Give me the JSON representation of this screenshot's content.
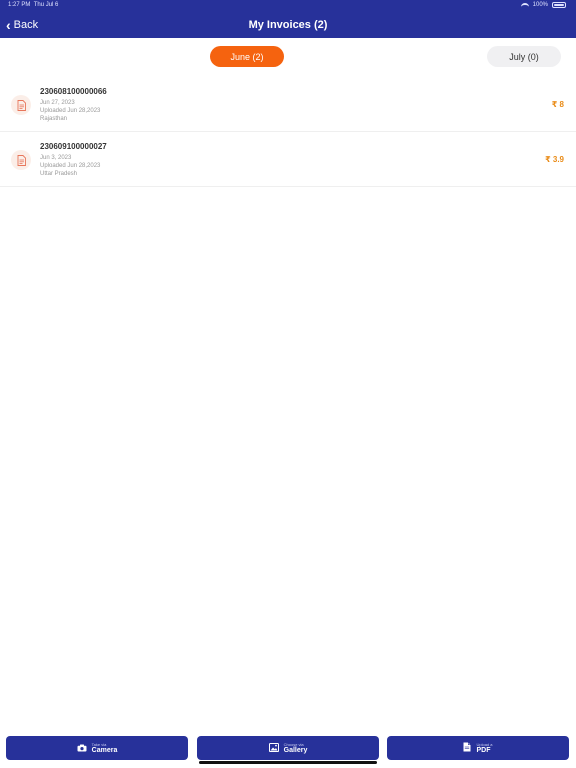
{
  "status_bar": {
    "time": "1:27 PM",
    "date": "Thu Jul 6",
    "battery": "100%"
  },
  "header": {
    "back_label": "Back",
    "title": "My Invoices (2)",
    "bg_color": "#27319a"
  },
  "tabs": [
    {
      "label": "June (2)",
      "selected": true,
      "color": "#f5630f"
    },
    {
      "label": "July (0)",
      "selected": false
    }
  ],
  "invoices": [
    {
      "id": "230608100000066",
      "date": "Jun 27, 2023",
      "uploaded": "Uploaded Jun 28,2023",
      "state": "Rajasthan",
      "amount": "₹ 8",
      "icon": "document-icon"
    },
    {
      "id": "230609100000027",
      "date": "Jun 3, 2023",
      "uploaded": "Uploaded Jun 28,2023",
      "state": "Uttar Pradesh",
      "amount": "₹ 3.9",
      "icon": "document-icon"
    }
  ],
  "actions": [
    {
      "sub": "Take via",
      "label": "Camera",
      "icon": "camera-icon"
    },
    {
      "sub": "Choose via",
      "label": "Gallery",
      "icon": "gallery-icon"
    },
    {
      "sub": "Upload a",
      "label": "PDF",
      "icon": "pdf-icon"
    }
  ],
  "colors": {
    "accent_orange": "#f5630f",
    "amount_orange": "#e98b17",
    "navy": "#27319a"
  }
}
